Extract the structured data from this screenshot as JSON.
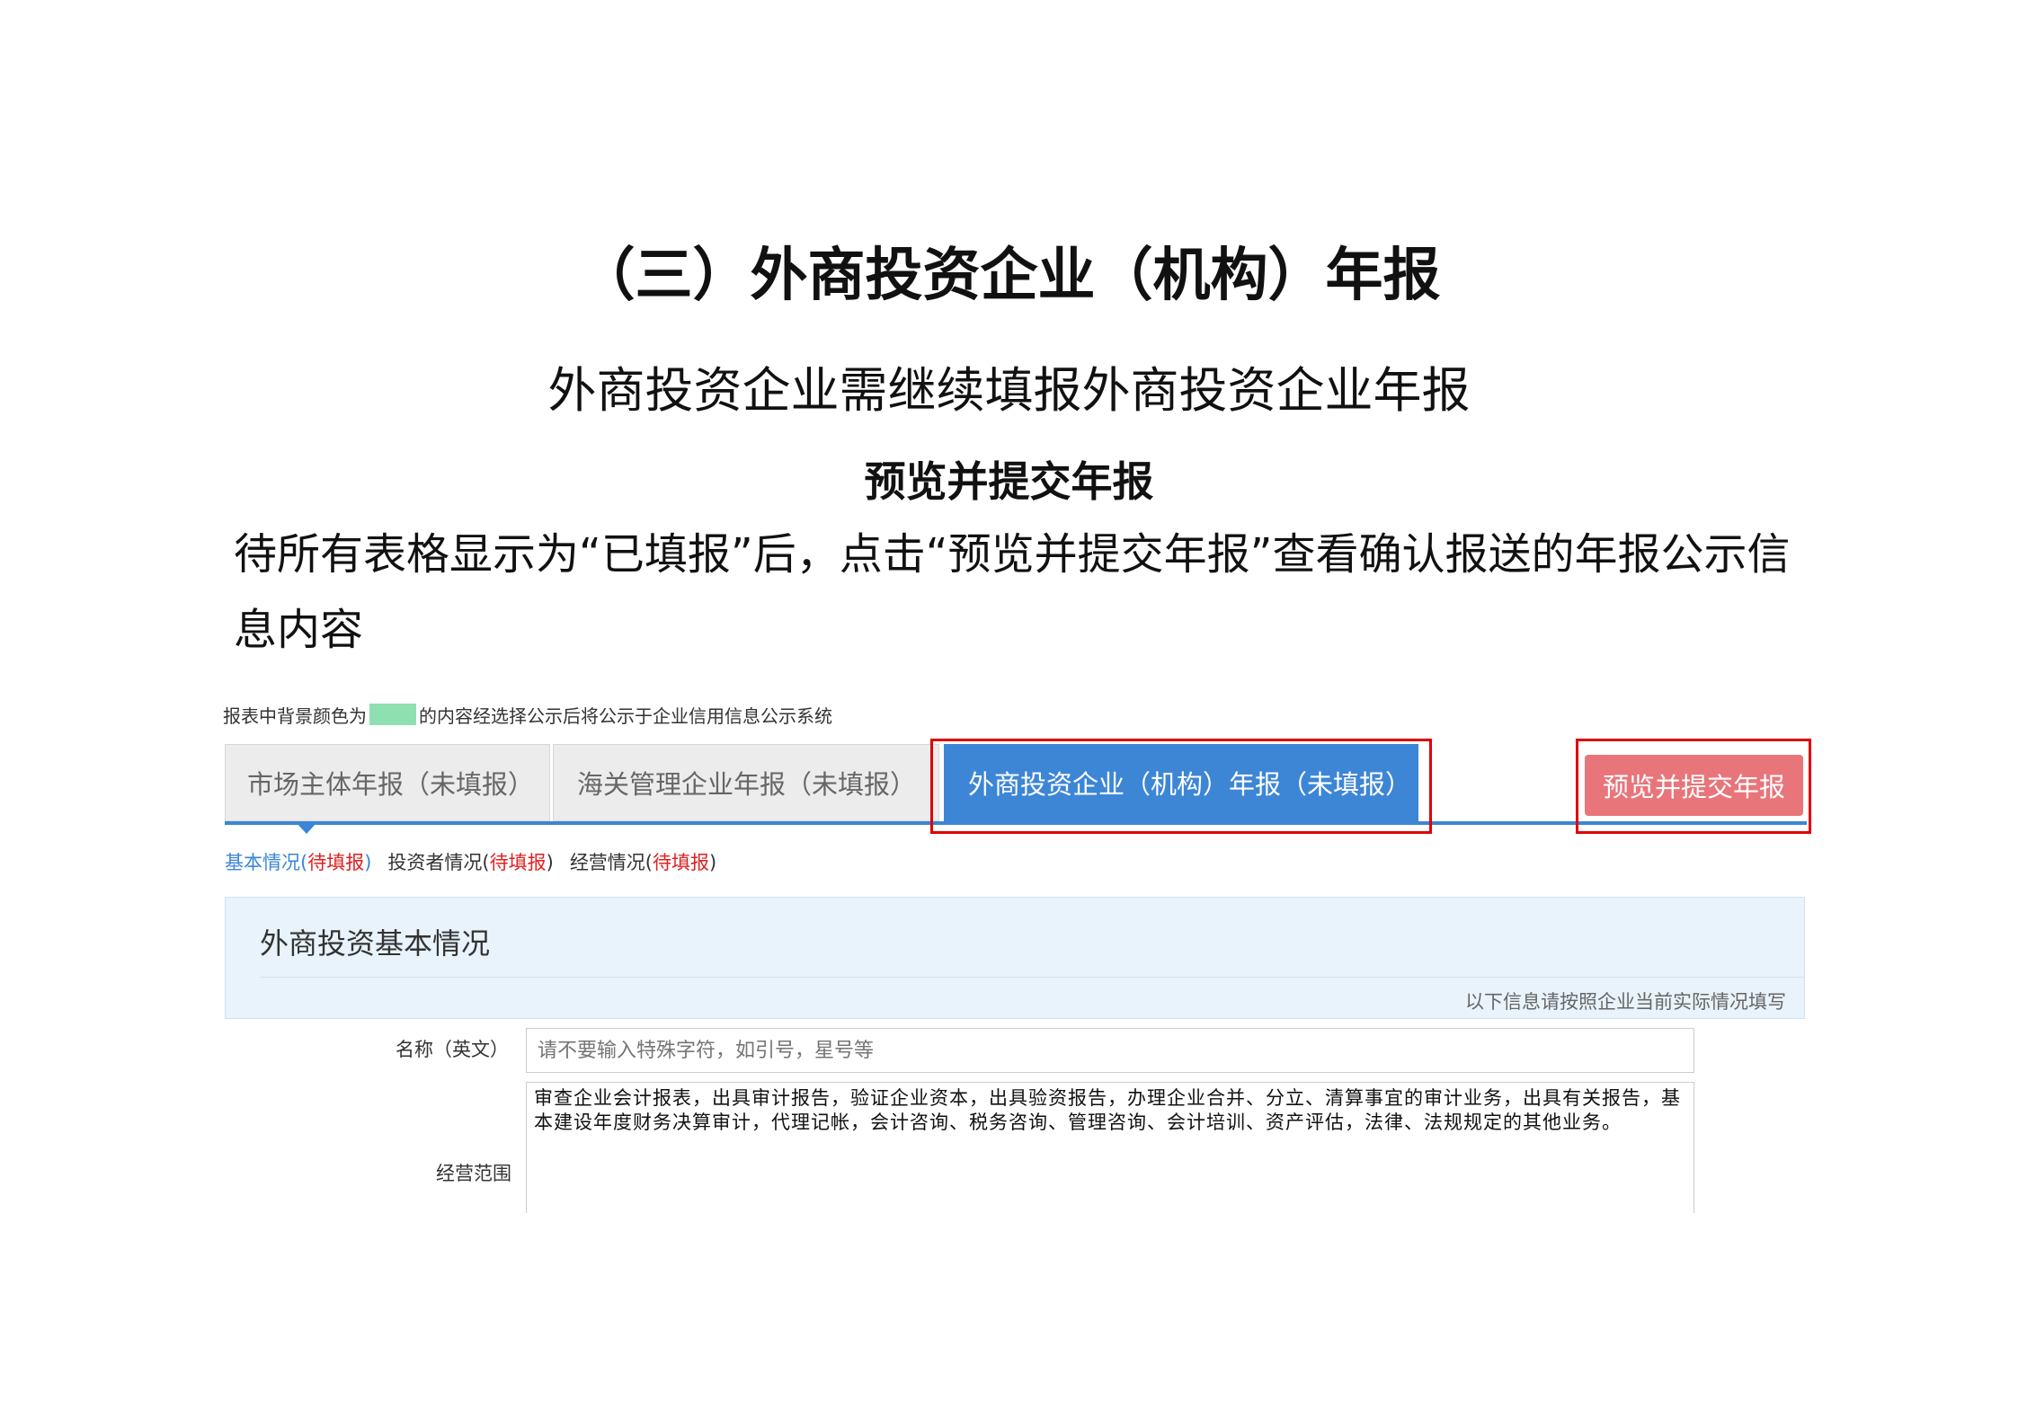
{
  "slide": {
    "title": "（三）外商投资企业（机构）年报",
    "subtitle": "外商投资企业需继续填报外商投资企业年报",
    "heading": "预览并提交年报",
    "instruction": "待所有表格显示为“已填报”后，点击“预览并提交年报”查看确认报送的年报公示信息内容"
  },
  "screenshot": {
    "legend": {
      "prefix": "报表中背景颜色为",
      "suffix": "的内容经选择公示后将公示于企业信用信息公示系统",
      "swatch_color": "#8fe0b0"
    },
    "tabs": [
      {
        "label": "市场主体年报（未填报）",
        "active": false
      },
      {
        "label": "海关管理企业年报（未填报）",
        "active": false
      },
      {
        "label": "外商投资企业（机构）年报（未填报）",
        "active": true
      }
    ],
    "submit_button": "预览并提交年报",
    "subtabs": [
      {
        "label": "基本情况(",
        "status": "待填报",
        "close": ")",
        "active": true
      },
      {
        "label": "投资者情况(",
        "status": "待填报",
        "close": ")",
        "active": false
      },
      {
        "label": "经营情况(",
        "status": "待填报",
        "close": ")",
        "active": false
      }
    ],
    "section": {
      "title": "外商投资基本情况",
      "hint": "以下信息请按照企业当前实际情况填写"
    },
    "fields": {
      "name_label": "名称（英文）",
      "name_placeholder": "请不要输入特殊字符，如引号，星号等",
      "scope_label": "经营范围",
      "scope_value": "审查企业会计报表，出具审计报告，验证企业资本，出具验资报告，办理企业合并、分立、清算事宜的审计业务，出具有关报告，基本建设年度财务决算审计，代理记帐，会计咨询、税务咨询、管理咨询、会计培训、资产评估，法律、法规规定的其他业务。"
    },
    "colors": {
      "tab_active": "#3d86d6",
      "submit_button": "#e8757a",
      "highlight": "#e00000",
      "status_text": "#e02020"
    }
  }
}
